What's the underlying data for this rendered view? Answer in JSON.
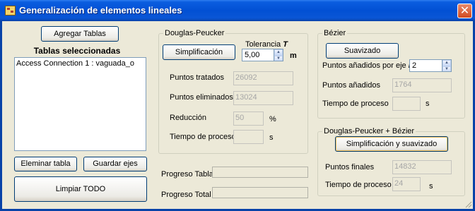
{
  "window": {
    "title": "Generalización de elementos lineales"
  },
  "left": {
    "add_tables": "Agregar Tablas",
    "selected_label": "Tablas seleccionadas",
    "list_items": [
      "Access Connection 1 : vaguada_o"
    ],
    "remove_table": "Eleminar tabla",
    "save_axes": "Guardar ejes",
    "clear_all": "Limpiar TODO"
  },
  "douglas": {
    "group_title": "Douglas-Peucker",
    "simplify_button": "Simplificación",
    "tolerance_label": "Tolerancia",
    "tolerance_symbol": "T",
    "tolerance_value": "5,00",
    "tolerance_unit": "m",
    "treated_label": "Puntos tratados",
    "treated_value": "26092",
    "removed_label": "Puntos eliminados",
    "removed_value": "13024",
    "reduction_label": "Reducción",
    "reduction_value": "50",
    "reduction_unit": "%",
    "time_label": "Tiempo de proceso",
    "time_value": "",
    "time_unit": "s"
  },
  "bezier": {
    "group_title": "Bézier",
    "smooth_button": "Suavizado",
    "points_per_axis_label": "Puntos añadidos por eje",
    "points_per_axis_symbol": "k",
    "points_per_axis_value": "2",
    "added_label": "Puntos añadidos",
    "added_value": "1764",
    "time_label": "Tiempo de proceso",
    "time_value": "",
    "time_unit": "s"
  },
  "combined": {
    "group_title": "Douglas-Peucker + Bézier",
    "button": "Simplificación y suavizado",
    "final_label": "Puntos finales",
    "final_value": "14832",
    "time_label": "Tiempo de proceso",
    "time_value": "24",
    "time_unit": "s"
  },
  "progress": {
    "table_label": "Progreso Tabla",
    "table_value": 0,
    "total_label": "Progreso Total",
    "total_value": 0
  },
  "colors": {
    "titlebar": "#0250d4",
    "close": "#d24a20",
    "face": "#ece9d8"
  }
}
